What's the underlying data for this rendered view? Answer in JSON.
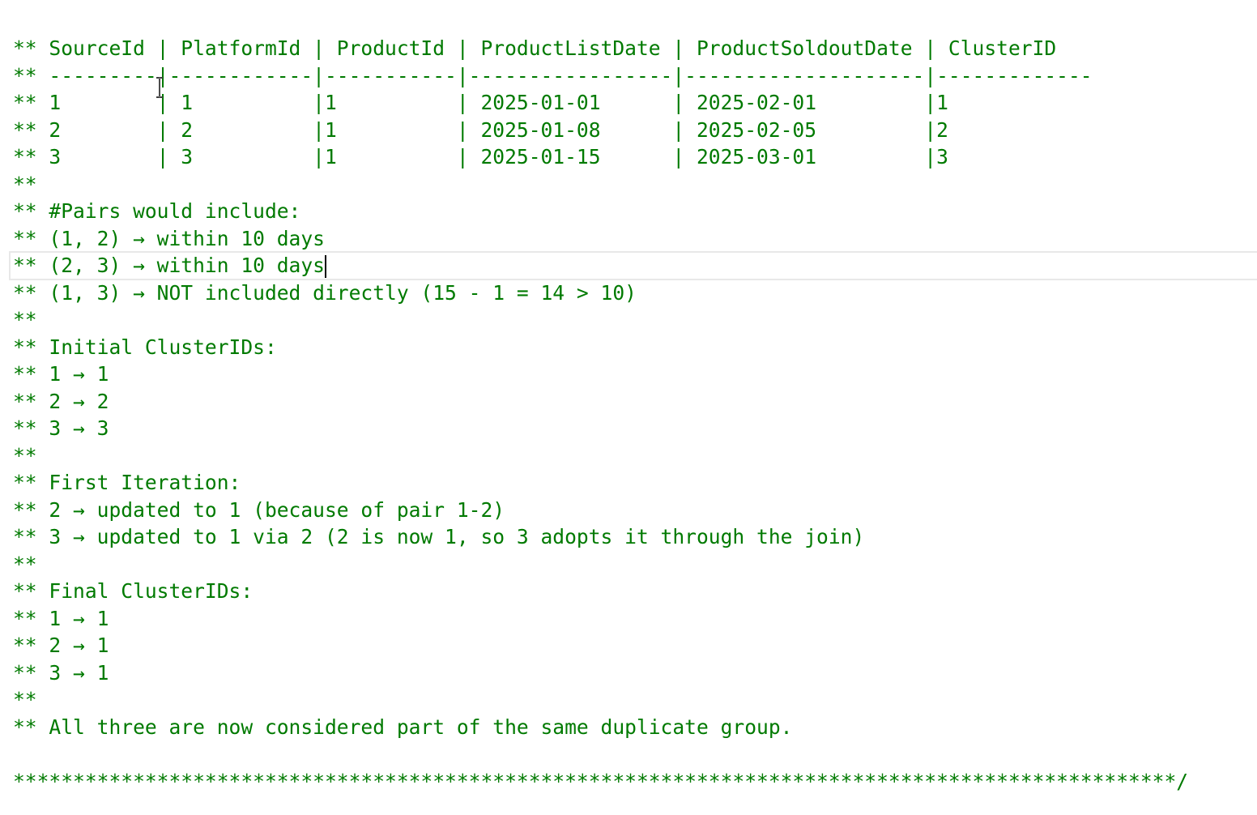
{
  "editor": {
    "text_color": "#007A00",
    "background": "#ffffff",
    "current_line_index": 9,
    "lines": [
      "** SourceId | PlatformId | ProductId | ProductListDate | ProductSoldoutDate | ClusterID",
      "** ---------|------------|-----------|-----------------|--------------------|-------------",
      "** 1        | 1          |1          | 2025-01-01      | 2025-02-01         |1",
      "** 2        | 2          |1          | 2025-01-08      | 2025-02-05         |2",
      "** 3        | 3          |1          | 2025-01-15      | 2025-03-01         |3",
      "**",
      "** #Pairs would include:",
      "** (1, 2) → within 10 days",
      "",
      "** (2, 3) → within 10 days",
      "** (1, 3) → NOT included directly (15 - 1 = 14 > 10)",
      "**",
      "** Initial ClusterIDs:",
      "** 1 → 1",
      "** 2 → 2",
      "** 3 → 3",
      "**",
      "** First Iteration:",
      "** 2 → updated to 1 (because of pair 1-2)",
      "** 3 → updated to 1 via 2 (2 is now 1, so 3 adopts it through the join)",
      "**",
      "** Final ClusterIDs:",
      "** 1 → 1",
      "** 2 → 1",
      "** 3 → 1",
      "**",
      "** All three are now considered part of the same duplicate group.",
      "",
      "*************************************************************************************************/"
    ]
  },
  "icons": {
    "mouse_cursor": "i-beam-cursor-icon",
    "text_caret": "text-caret-icon"
  }
}
